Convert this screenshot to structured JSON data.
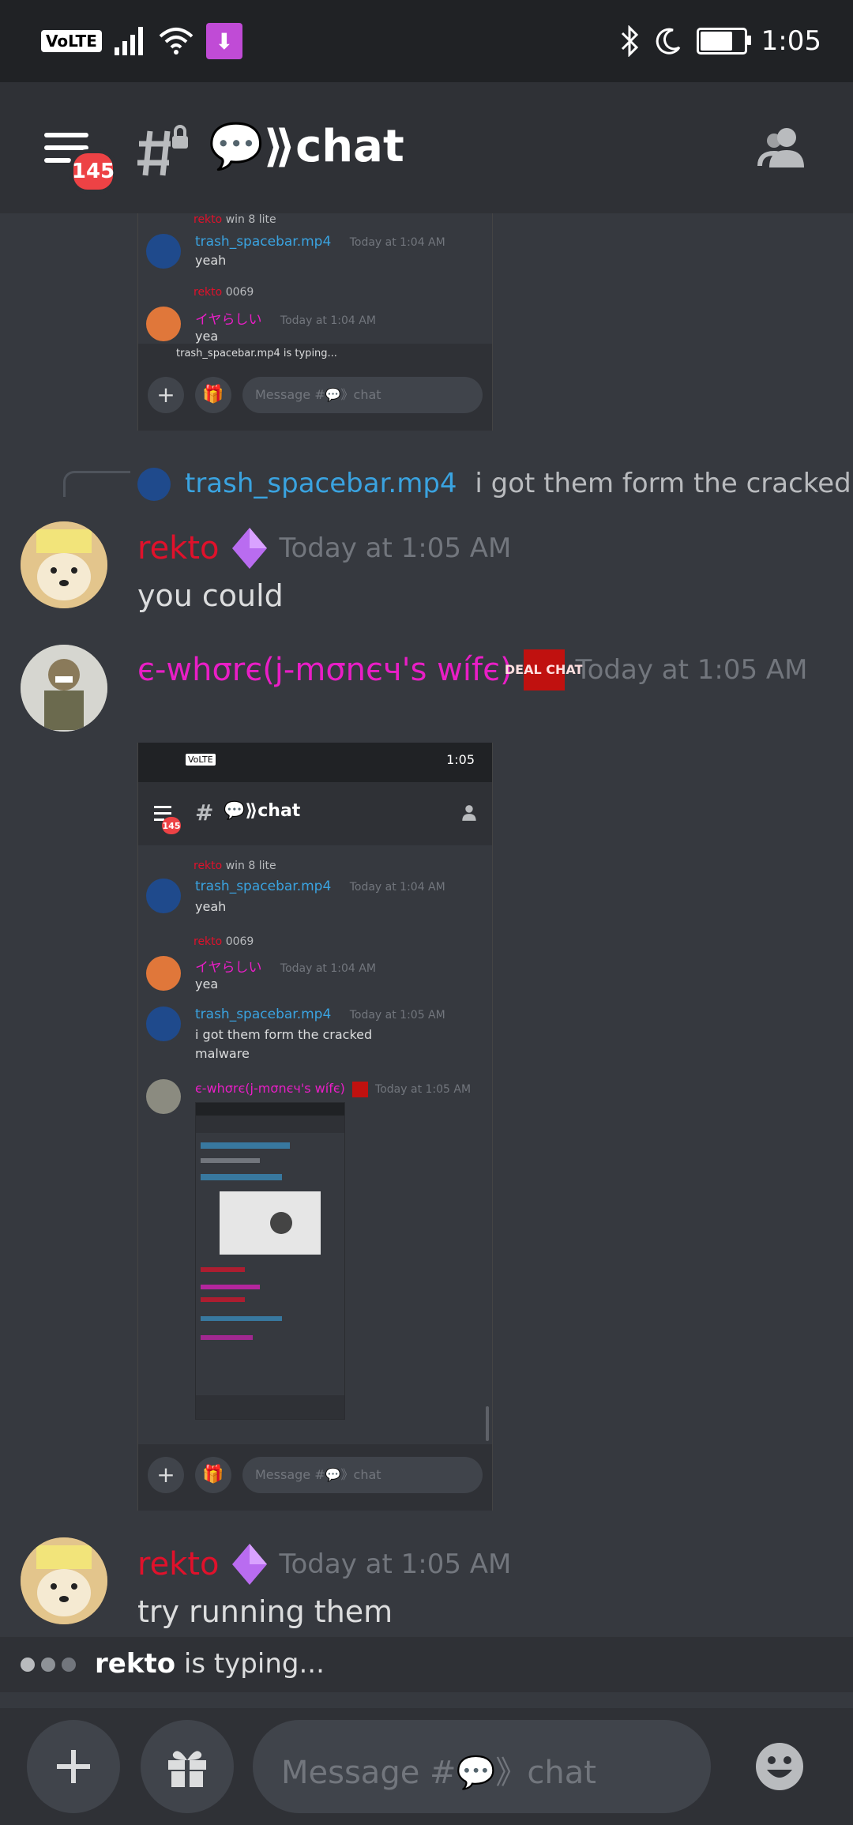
{
  "status_bar": {
    "volte": "VoLTE",
    "time": "1:05",
    "icons": [
      "signal-icon",
      "wifi-icon",
      "download-icon",
      "bluetooth-icon",
      "moon-icon",
      "battery-icon"
    ]
  },
  "header": {
    "menu_badge": "145",
    "channel_title": "💬⟫chat",
    "icons": [
      "menu-icon",
      "locked-hash-icon",
      "members-icon"
    ]
  },
  "top_shot": {
    "reply1_user": "rekto",
    "reply1_text": "win 8 lite",
    "msg1_user": "trash_spacebar.mp4",
    "msg1_ts": "Today at 1:04 AM",
    "msg1_text": "yeah",
    "reply2_user": "rekto",
    "reply2_text": "0069",
    "msg2_user": "イヤらしい",
    "msg2_ts": "Today at 1:04 AM",
    "msg2_text": "yea",
    "typing": "trash_spacebar.mp4 is typing...",
    "input_placeholder": "Message #💬》chat"
  },
  "reply_preview": {
    "user": "trash_spacebar.mp4",
    "text": "i got them form the cracked"
  },
  "messages": [
    {
      "user": "rekto",
      "user_color": "#e0112b",
      "timestamp": "Today at 1:05 AM",
      "text": "you could"
    },
    {
      "user": "є-whσrє(j-mσnєч's wífє)",
      "user_color": "#e91ec6",
      "timestamp": "Today at 1:05 AM",
      "badge_text": "DEAL CHAT"
    },
    {
      "user": "rekto",
      "user_color": "#e0112b",
      "timestamp": "Today at 1:05 AM",
      "text": "try running them"
    }
  ],
  "big_shot": {
    "time": "1:05",
    "badge": "145",
    "title": "💬⟫chat",
    "reply1_user": "rekto",
    "reply1_text": "win 8 lite",
    "m1_user": "trash_spacebar.mp4",
    "m1_ts": "Today at 1:04 AM",
    "m1_text": "yeah",
    "reply2_user": "rekto",
    "reply2_text": "0069",
    "m2_user": "イヤらしい",
    "m2_ts": "Today at 1:04 AM",
    "m2_text": "yea",
    "m3_user": "trash_spacebar.mp4",
    "m3_ts": "Today at 1:05 AM",
    "m3_text_1": "i got them form the cracked",
    "m3_text_2": "malware",
    "m4_user": "є-whσrє(j-mσnєч's wífє)",
    "m4_ts": "Today at 1:05 AM",
    "input_placeholder": "Message #💬》chat"
  },
  "typing_indicator": {
    "user": "rekto",
    "suffix": " is typing..."
  },
  "composer": {
    "placeholder": "Message #💬》chat",
    "icons": [
      "plus-icon",
      "gift-icon",
      "emoji-icon"
    ]
  },
  "colors": {
    "background": "#36393f",
    "header": "#2f3136",
    "trash_spacebar": "#3aa3e0",
    "rekto": "#e0112b",
    "wife": "#e91ec6",
    "iyarashii": "#e91ec6",
    "timestamp": "#72767d"
  }
}
